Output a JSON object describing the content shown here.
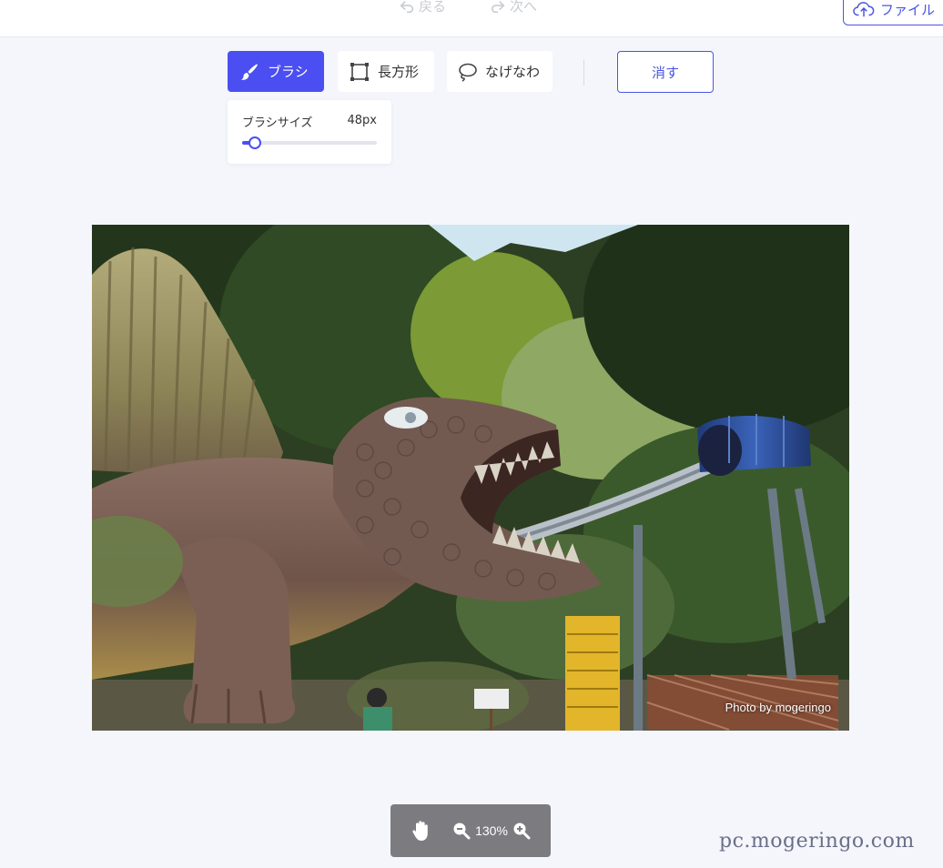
{
  "topbar": {
    "undo_label": "戻る",
    "redo_label": "次へ",
    "upload_label": "ファイル"
  },
  "toolbar": {
    "tools": [
      {
        "label": "ブラシ",
        "icon": "brush-icon",
        "active": true
      },
      {
        "label": "長方形",
        "icon": "rectangle-icon",
        "active": false
      },
      {
        "label": "なげなわ",
        "icon": "lasso-icon",
        "active": false
      }
    ],
    "erase_label": "消す"
  },
  "brush_panel": {
    "label": "ブラシサイズ",
    "value": "48px",
    "slider_fraction": 0.09
  },
  "canvas": {
    "photo_credit": "Photo by mogeringo"
  },
  "zoom": {
    "value": "130%"
  },
  "watermark": "pc.mogeringo.com",
  "colors": {
    "accent": "#4b4ef0",
    "background": "#f4f6fb",
    "zoom_bar": "#7c7c80"
  }
}
